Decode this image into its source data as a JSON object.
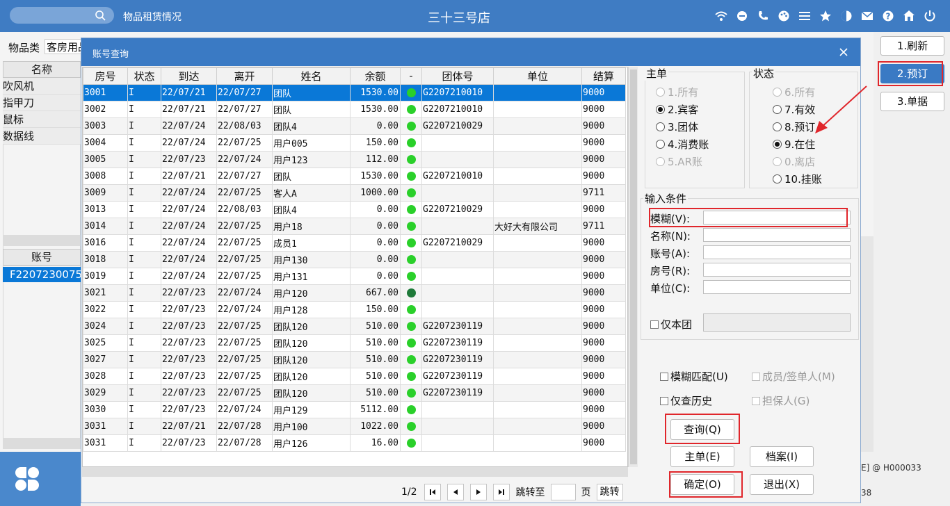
{
  "topbar": {
    "app_title": "物品租赁情况",
    "store_name": "三十三号店",
    "icons": [
      "wifi-icon",
      "chat-icon",
      "phone-icon",
      "palette-icon",
      "menu-icon",
      "star-icon",
      "contrast-icon",
      "mail-icon",
      "help-icon",
      "home-icon",
      "power-icon"
    ]
  },
  "background": {
    "category_label": "物品类",
    "category_value": "客房用品",
    "name_header": "名称",
    "items": [
      "吹风机",
      "指甲刀",
      "鼠标",
      "数据线"
    ],
    "account_header": "账号",
    "account_value": "F2207230075",
    "status_text1": "E] @ H000033",
    "status_text2": "38"
  },
  "right_buttons": [
    {
      "label": "1.刷新",
      "active": false
    },
    {
      "label": "2.预订",
      "active": true
    },
    {
      "label": "3.单据",
      "active": false
    }
  ],
  "dialog": {
    "title": "账号查询",
    "columns": [
      "房号",
      "状态",
      "到达",
      "离开",
      "姓名",
      "余额",
      "-",
      "团体号",
      "单位",
      "结算"
    ],
    "rows": [
      {
        "room": "3001",
        "status": "I",
        "arrive": "22/07/21",
        "depart": "22/07/27",
        "name": "团队",
        "balance": "1530.00",
        "dot": "green",
        "group": "G2207210010",
        "unit": "",
        "settle": "9000"
      },
      {
        "room": "3002",
        "status": "I",
        "arrive": "22/07/21",
        "depart": "22/07/27",
        "name": "团队",
        "balance": "1530.00",
        "dot": "green",
        "group": "G2207210010",
        "unit": "",
        "settle": "9000"
      },
      {
        "room": "3003",
        "status": "I",
        "arrive": "22/07/24",
        "depart": "22/08/03",
        "name": "团队4",
        "balance": "0.00",
        "dot": "green",
        "group": "G2207210029",
        "unit": "",
        "settle": "9000"
      },
      {
        "room": "3004",
        "status": "I",
        "arrive": "22/07/24",
        "depart": "22/07/25",
        "name": "用户005",
        "balance": "150.00",
        "dot": "green",
        "group": "",
        "unit": "",
        "settle": "9000"
      },
      {
        "room": "3005",
        "status": "I",
        "arrive": "22/07/23",
        "depart": "22/07/24",
        "name": "用户123",
        "balance": "112.00",
        "dot": "green",
        "group": "",
        "unit": "",
        "settle": "9000"
      },
      {
        "room": "3008",
        "status": "I",
        "arrive": "22/07/21",
        "depart": "22/07/27",
        "name": "团队",
        "balance": "1530.00",
        "dot": "green",
        "group": "G2207210010",
        "unit": "",
        "settle": "9000"
      },
      {
        "room": "3009",
        "status": "I",
        "arrive": "22/07/24",
        "depart": "22/07/25",
        "name": "客人A",
        "balance": "1000.00",
        "dot": "green",
        "group": "",
        "unit": "",
        "settle": "9711"
      },
      {
        "room": "3013",
        "status": "I",
        "arrive": "22/07/24",
        "depart": "22/08/03",
        "name": "团队4",
        "balance": "0.00",
        "dot": "green",
        "group": "G2207210029",
        "unit": "",
        "settle": "9000"
      },
      {
        "room": "3014",
        "status": "I",
        "arrive": "22/07/24",
        "depart": "22/07/25",
        "name": "用户18",
        "balance": "0.00",
        "dot": "green",
        "group": "",
        "unit": "大好大有限公司",
        "settle": "9711"
      },
      {
        "room": "3016",
        "status": "I",
        "arrive": "22/07/24",
        "depart": "22/07/25",
        "name": "成员1",
        "balance": "0.00",
        "dot": "green",
        "group": "G2207210029",
        "unit": "",
        "settle": "9000"
      },
      {
        "room": "3018",
        "status": "I",
        "arrive": "22/07/24",
        "depart": "22/07/25",
        "name": "用户130",
        "balance": "0.00",
        "dot": "green",
        "group": "",
        "unit": "",
        "settle": "9000"
      },
      {
        "room": "3019",
        "status": "I",
        "arrive": "22/07/24",
        "depart": "22/07/25",
        "name": "用户131",
        "balance": "0.00",
        "dot": "green",
        "group": "",
        "unit": "",
        "settle": "9000"
      },
      {
        "room": "3021",
        "status": "I",
        "arrive": "22/07/23",
        "depart": "22/07/24",
        "name": "用户120",
        "balance": "667.00",
        "dot": "dark",
        "group": "",
        "unit": "",
        "settle": "9000"
      },
      {
        "room": "3022",
        "status": "I",
        "arrive": "22/07/23",
        "depart": "22/07/24",
        "name": "用户128",
        "balance": "150.00",
        "dot": "green",
        "group": "",
        "unit": "",
        "settle": "9000"
      },
      {
        "room": "3024",
        "status": "I",
        "arrive": "22/07/23",
        "depart": "22/07/25",
        "name": "团队120",
        "balance": "510.00",
        "dot": "green",
        "group": "G2207230119",
        "unit": "",
        "settle": "9000"
      },
      {
        "room": "3025",
        "status": "I",
        "arrive": "22/07/23",
        "depart": "22/07/25",
        "name": "团队120",
        "balance": "510.00",
        "dot": "green",
        "group": "G2207230119",
        "unit": "",
        "settle": "9000"
      },
      {
        "room": "3027",
        "status": "I",
        "arrive": "22/07/23",
        "depart": "22/07/25",
        "name": "团队120",
        "balance": "510.00",
        "dot": "green",
        "group": "G2207230119",
        "unit": "",
        "settle": "9000"
      },
      {
        "room": "3028",
        "status": "I",
        "arrive": "22/07/23",
        "depart": "22/07/25",
        "name": "团队120",
        "balance": "510.00",
        "dot": "green",
        "group": "G2207230119",
        "unit": "",
        "settle": "9000"
      },
      {
        "room": "3029",
        "status": "I",
        "arrive": "22/07/23",
        "depart": "22/07/25",
        "name": "团队120",
        "balance": "510.00",
        "dot": "green",
        "group": "G2207230119",
        "unit": "",
        "settle": "9000"
      },
      {
        "room": "3030",
        "status": "I",
        "arrive": "22/07/23",
        "depart": "22/07/24",
        "name": "用户129",
        "balance": "5112.00",
        "dot": "green",
        "group": "",
        "unit": "",
        "settle": "9000"
      },
      {
        "room": "3031",
        "status": "I",
        "arrive": "22/07/21",
        "depart": "22/07/28",
        "name": "用户100",
        "balance": "1022.00",
        "dot": "green",
        "group": "",
        "unit": "",
        "settle": "9000"
      },
      {
        "room": "3031",
        "status": "I",
        "arrive": "22/07/23",
        "depart": "22/07/28",
        "name": "用户126",
        "balance": "16.00",
        "dot": "green",
        "group": "",
        "unit": "",
        "settle": "9000"
      }
    ],
    "pager": {
      "page": "1/2",
      "jump_label": "跳转至",
      "page_unit": "页",
      "go_label": "跳转"
    },
    "main_group": {
      "title": "主单",
      "options": [
        {
          "label": "1.所有",
          "checked": false,
          "disabled": true
        },
        {
          "label": "2.宾客",
          "checked": true,
          "disabled": false
        },
        {
          "label": "3.团体",
          "checked": false,
          "disabled": false
        },
        {
          "label": "4.消费账",
          "checked": false,
          "disabled": false
        },
        {
          "label": "5.AR账",
          "checked": false,
          "disabled": true
        }
      ]
    },
    "status_group": {
      "title": "状态",
      "options": [
        {
          "label": "6.所有",
          "checked": false,
          "disabled": true
        },
        {
          "label": "7.有效",
          "checked": false,
          "disabled": false
        },
        {
          "label": "8.预订",
          "checked": false,
          "disabled": false
        },
        {
          "label": "9.在住",
          "checked": true,
          "disabled": false
        },
        {
          "label": "0.离店",
          "checked": false,
          "disabled": true
        },
        {
          "label": "10.挂账",
          "checked": false,
          "disabled": false
        }
      ]
    },
    "input_group": {
      "title": "输入条件",
      "fields": [
        {
          "label": "模糊(V):",
          "value": ""
        },
        {
          "label": "名称(N):",
          "value": ""
        },
        {
          "label": "账号(A):",
          "value": ""
        },
        {
          "label": "房号(R):",
          "value": ""
        },
        {
          "label": "单位(C):",
          "value": ""
        }
      ],
      "only_group_label": "仅本团"
    },
    "checks": {
      "fuzzy_match": "模糊匹配(U)",
      "member_signer": "成员/签单人(M)",
      "history_only": "仅查历史",
      "guarantor": "担保人(G)"
    },
    "buttons": {
      "query": "查询(Q)",
      "master": "主单(E)",
      "profile": "档案(I)",
      "ok": "确定(O)",
      "exit": "退出(X)"
    }
  },
  "colors": {
    "titlebar": "#3a7ac4",
    "topbar": "#3f7cc3",
    "selection": "#0a78d7",
    "highlight_red": "#e0262b",
    "dot_green": "#2ad02a"
  }
}
